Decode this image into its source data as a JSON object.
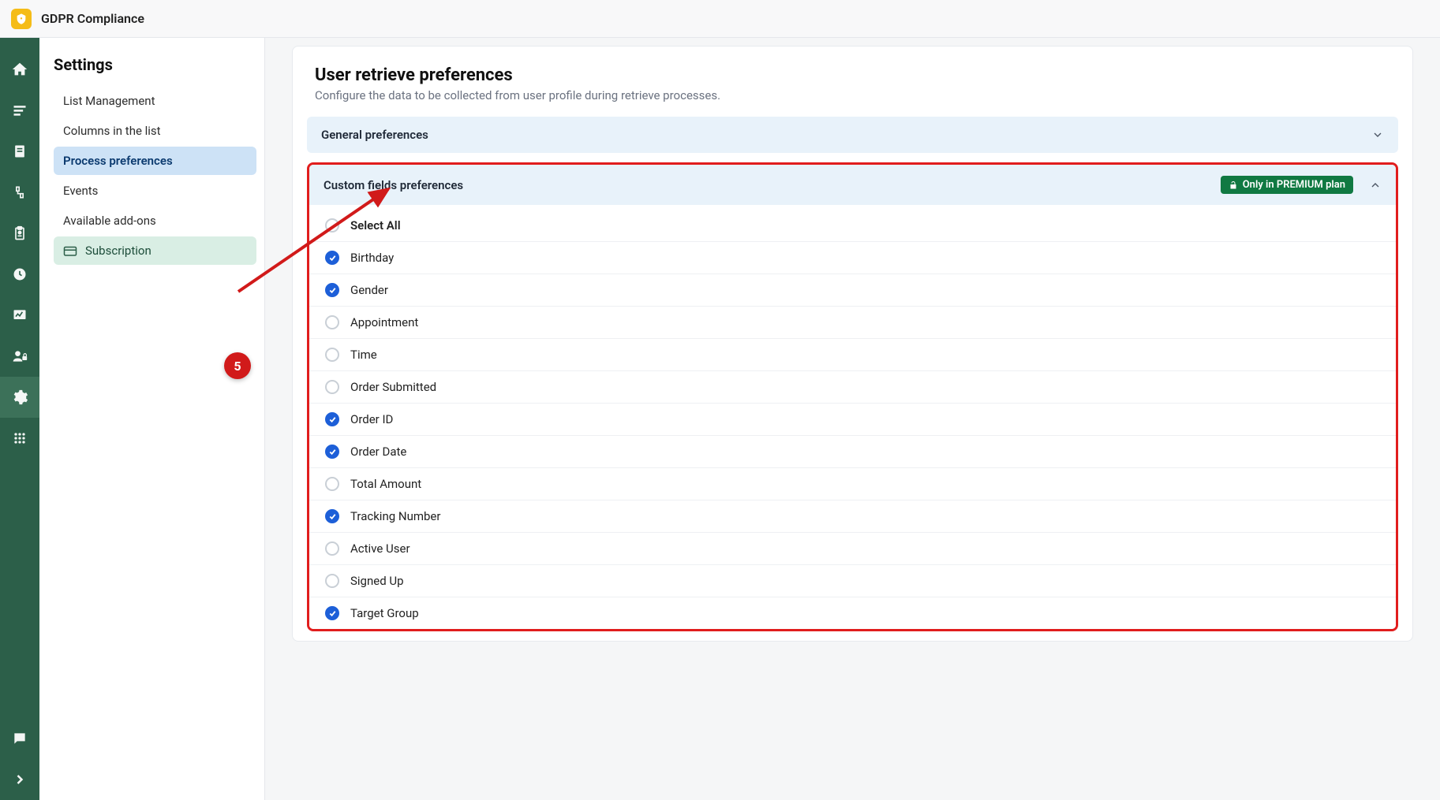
{
  "header": {
    "title": "GDPR Compliance"
  },
  "sidebar": {
    "title": "Settings",
    "items": [
      {
        "label": "List Management"
      },
      {
        "label": "Columns in the list"
      },
      {
        "label": "Process preferences"
      },
      {
        "label": "Events"
      },
      {
        "label": "Available add-ons"
      },
      {
        "label": "Subscription"
      }
    ]
  },
  "main": {
    "title": "User retrieve preferences",
    "subtitle": "Configure the data to be collected from user profile during retrieve processes.",
    "sections": {
      "general": {
        "label": "General preferences"
      },
      "custom": {
        "label": "Custom fields preferences",
        "badge": "Only in PREMIUM plan",
        "fields": [
          {
            "label": "Select All",
            "checked": false
          },
          {
            "label": "Birthday",
            "checked": true
          },
          {
            "label": "Gender",
            "checked": true
          },
          {
            "label": "Appointment",
            "checked": false
          },
          {
            "label": "Time",
            "checked": false
          },
          {
            "label": "Order Submitted",
            "checked": false
          },
          {
            "label": "Order ID",
            "checked": true
          },
          {
            "label": "Order Date",
            "checked": true
          },
          {
            "label": "Total Amount",
            "checked": false
          },
          {
            "label": "Tracking Number",
            "checked": true
          },
          {
            "label": "Active User",
            "checked": false
          },
          {
            "label": "Signed Up",
            "checked": false
          },
          {
            "label": "Target Group",
            "checked": true
          }
        ]
      }
    }
  },
  "annotation": {
    "number": "5"
  }
}
